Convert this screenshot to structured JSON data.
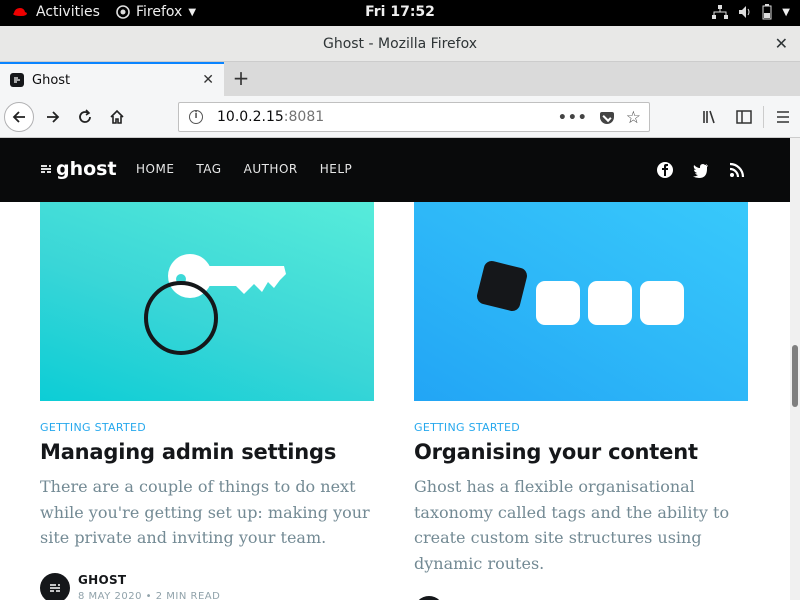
{
  "system": {
    "activities": "Activities",
    "app_menu": "Firefox",
    "clock": "Fri 17:52"
  },
  "window": {
    "title": "Ghost - Mozilla Firefox"
  },
  "tab": {
    "label": "Ghost"
  },
  "urlbar": {
    "host": "10.0.2.15",
    "port": ":8081"
  },
  "site": {
    "logo_text": "ghost",
    "nav": [
      "HOME",
      "TAG",
      "AUTHOR",
      "HELP"
    ]
  },
  "cards": [
    {
      "tag": "GETTING STARTED",
      "title": "Managing admin settings",
      "excerpt": "There are a couple of things to do next while you're getting set up: making your site private and inviting your team.",
      "author": "GHOST",
      "date": "8 MAY 2020",
      "read_time": "2 MIN READ"
    },
    {
      "tag": "GETTING STARTED",
      "title": "Organising your content",
      "excerpt": "Ghost has a flexible organisational taxonomy called tags and the ability to create custom site structures using dynamic routes."
    }
  ],
  "colors": {
    "accent": "#26a8ed",
    "header_bg": "#090a0b",
    "card1_gradient": "#0ccdd6",
    "card2_gradient": "#2eb8f8"
  }
}
